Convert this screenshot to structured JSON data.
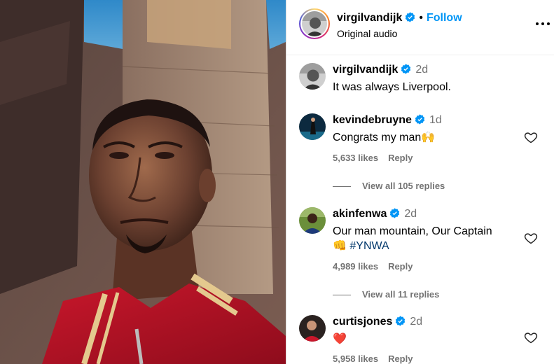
{
  "post": {
    "author": "virgilvandijk",
    "separator": "•",
    "follow_label": "Follow",
    "audio": "Original audio"
  },
  "comments": [
    {
      "user": "virgilvandijk",
      "time": "2d",
      "text": "It was always Liverpool.",
      "verified": true
    },
    {
      "user": "kevindebruyne",
      "time": "1d",
      "text": "Congrats my man",
      "emoji": "🙌",
      "likes": "5,633 likes",
      "reply_label": "Reply",
      "view_replies": "View all 105 replies",
      "verified": true
    },
    {
      "user": "akinfenwa",
      "time": "2d",
      "text": "Our man mountain, Our Captain",
      "emoji": "👊",
      "hashtag": "#YNWA",
      "likes": "4,989 likes",
      "reply_label": "Reply",
      "view_replies": "View all 11 replies",
      "verified": true
    },
    {
      "user": "curtisjones",
      "time": "2d",
      "emoji": "❤️",
      "likes": "5,958 likes",
      "reply_label": "Reply",
      "verified": true
    }
  ],
  "colors": {
    "link": "#0095f6",
    "verified": "#0095f6",
    "muted": "#737373",
    "hashtag": "#00376b"
  },
  "icons": {
    "more": "more-options-icon",
    "like": "heart-icon",
    "verified": "verified-badge-icon"
  }
}
